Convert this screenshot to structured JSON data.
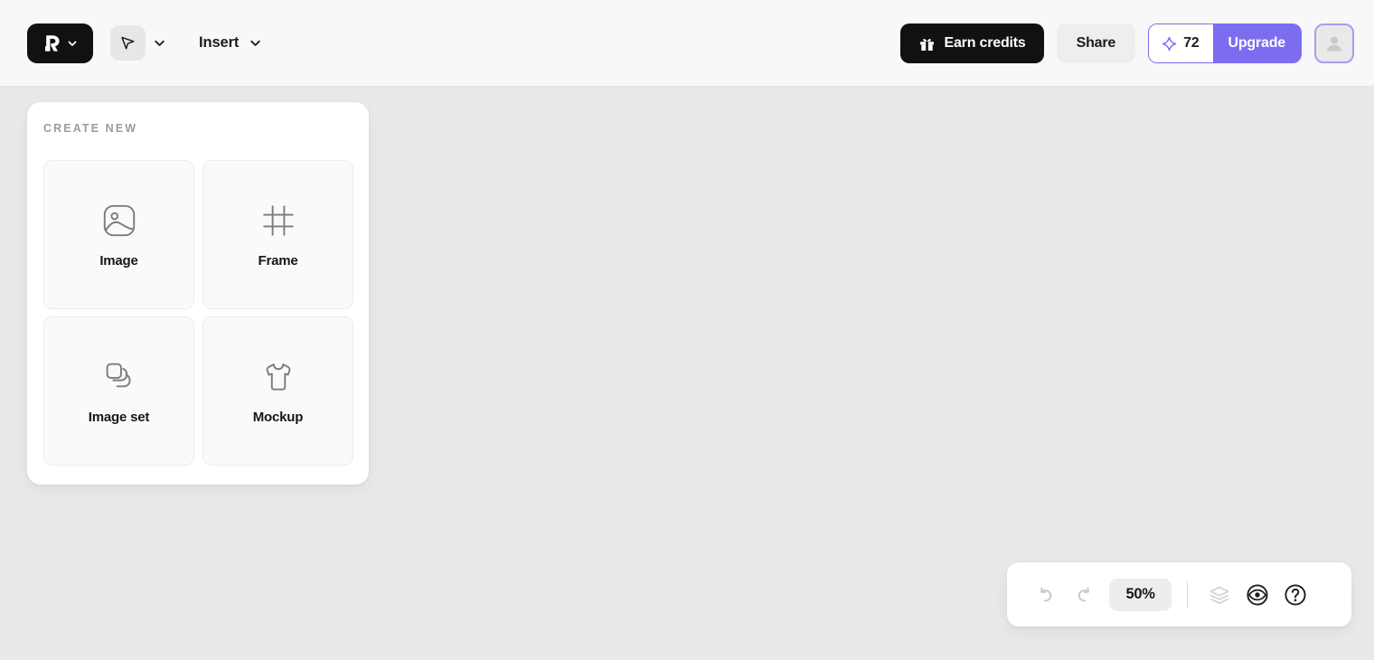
{
  "app": {
    "background_color": "#e9e9eb",
    "topbar_color": "#f8f8f8",
    "accent_color": "#7c6cf0"
  },
  "topbar": {
    "logo": {
      "name": "app-logo",
      "glyph": "R"
    },
    "logo_caret": "chevron-down-icon",
    "tool": {
      "name": "select-tool",
      "icon": "cursor-arrow-icon"
    },
    "tool_caret": "chevron-down-icon",
    "insert": {
      "label": "Insert",
      "caret": "chevron-down-icon"
    },
    "earn_credits": {
      "label": "Earn credits",
      "icon": "gift-icon"
    },
    "share": {
      "label": "Share"
    },
    "credits": {
      "value": "72",
      "icon": "diamond-sparkle-icon"
    },
    "upgrade": {
      "label": "Upgrade"
    },
    "avatar": {
      "icon": "user-avatar-icon"
    }
  },
  "create_panel": {
    "title": "CREATE NEW",
    "cards": [
      {
        "label": "Image",
        "icon": "image-icon"
      },
      {
        "label": "Frame",
        "icon": "frame-icon"
      },
      {
        "label": "Image set",
        "icon": "image-stack-icon"
      },
      {
        "label": "Mockup",
        "icon": "tshirt-icon"
      }
    ]
  },
  "bottom_toolbar": {
    "undo": {
      "icon": "undo-arrow-icon",
      "enabled": false
    },
    "redo": {
      "icon": "redo-arrow-icon",
      "enabled": false
    },
    "zoom": {
      "value": "50%"
    },
    "layers": {
      "icon": "layers-icon",
      "enabled": false
    },
    "preview": {
      "icon": "eye-circle-icon",
      "enabled": true
    },
    "help": {
      "icon": "question-circle-icon",
      "enabled": true
    }
  }
}
